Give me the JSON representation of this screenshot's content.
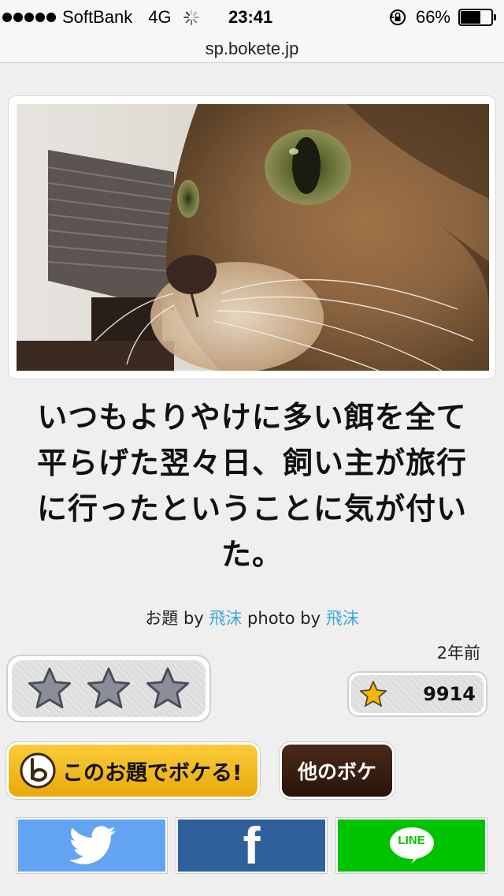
{
  "status_bar": {
    "carrier": "SoftBank",
    "network": "4G",
    "time": "23:41",
    "battery_percent_label": "66%",
    "battery_level": 0.66,
    "icons": [
      "signal-dots",
      "loading-spinner",
      "rotation-lock-icon",
      "battery-icon"
    ]
  },
  "browser": {
    "url": "sp.bokete.jp"
  },
  "post": {
    "caption": "いつもよりやけに多い餌を全て平らげた翌々日、飼い主が旅行に行ったということに気が付いた。",
    "credits": {
      "odai_prefix": "お題 by ",
      "odai_author": "飛沫",
      "photo_prefix": " photo by ",
      "photo_author": "飛沫"
    },
    "age": "2年前",
    "rating_stars_count": 3,
    "score": "9914"
  },
  "actions": {
    "boke_button_label": "このお題でボケる!",
    "other_boke_label": "他のボケ"
  },
  "share": {
    "line_label": "LINE",
    "facebook_glyph": "f"
  },
  "colors": {
    "accent_yellow": "#f4bd22",
    "dark_brown": "#3a1e10",
    "link_blue": "#3aa7d8",
    "twitter": "#62a3f2",
    "facebook": "#30609b",
    "line": "#00c300"
  }
}
